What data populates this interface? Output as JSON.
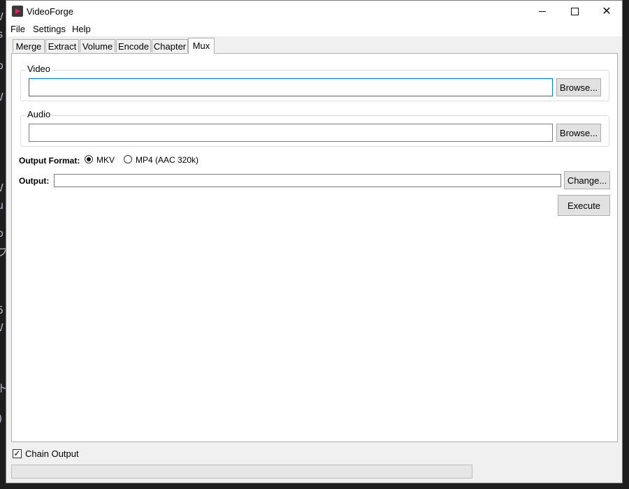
{
  "window": {
    "title": "VideoForge",
    "minimize_glyph": "",
    "close_glyph": "✕"
  },
  "menu": {
    "items": [
      "File",
      "Settings",
      "Help"
    ]
  },
  "tabs": [
    "Merge",
    "Extract",
    "Volume",
    "Encode",
    "Chapter",
    "Mux"
  ],
  "active_tab": "Mux",
  "mux": {
    "video": {
      "label": "Video",
      "value": "",
      "browse_label": "Browse..."
    },
    "audio": {
      "label": "Audio",
      "value": "",
      "browse_label": "Browse..."
    },
    "output_format": {
      "label": "Output Format:",
      "options": [
        "MKV",
        "MP4 (AAC 320k)"
      ],
      "selected": "MKV"
    },
    "output": {
      "label": "Output:",
      "value": "",
      "change_label": "Change..."
    },
    "execute_label": "Execute"
  },
  "footer": {
    "chain_output_label": "Chain Output",
    "chain_output_checked": true,
    "progress": 0
  },
  "colors": {
    "accent": "#0078d4",
    "icon_red": "#e0245e"
  },
  "icons": [
    "app-icon",
    "minimize-icon",
    "maximize-icon",
    "close-icon",
    "check-icon"
  ]
}
